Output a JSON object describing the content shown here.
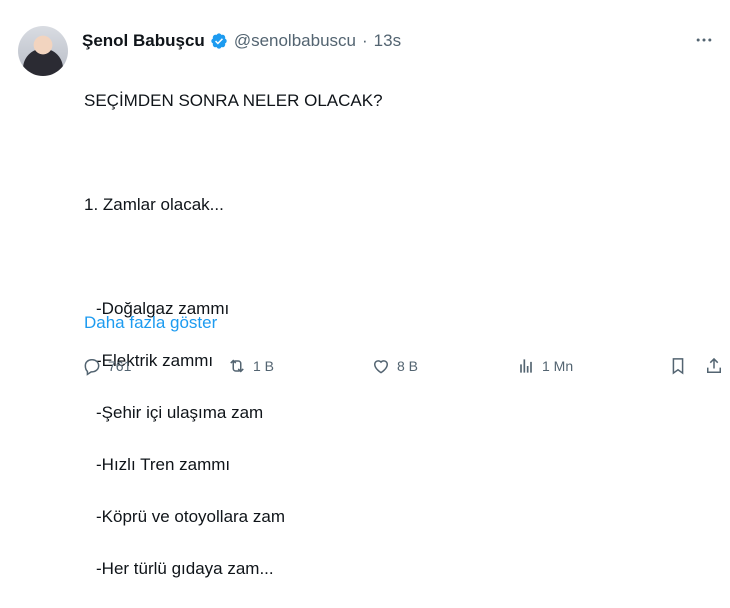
{
  "author": {
    "name": "Şenol Babuşcu",
    "handle": "@senolbabuscu",
    "separator": "·",
    "time": "13s"
  },
  "tweet": {
    "lines": [
      "SEÇİMDEN SONRA NELER OLACAK?",
      "",
      "1. Zamlar olacak...",
      "",
      "-Doğalgaz zammı",
      "-Elektrik zammı",
      "-Şehir içi ulaşıma zam",
      "-Hızlı Tren zammı",
      "-Köprü ve otoyollara zam",
      "-Her türlü gıdaya zam..."
    ],
    "show_more": "Daha fazla göster"
  },
  "actions": {
    "replies": "761",
    "retweets": "1 B",
    "likes": "8 B",
    "views": "1 Mn"
  },
  "colors": {
    "accent": "#1d9bf0",
    "muted": "#536471",
    "text": "#0f1419"
  },
  "icons": [
    "more-icon",
    "verified-icon",
    "reply-icon",
    "retweet-icon",
    "like-icon",
    "views-icon",
    "bookmark-icon",
    "share-icon"
  ]
}
